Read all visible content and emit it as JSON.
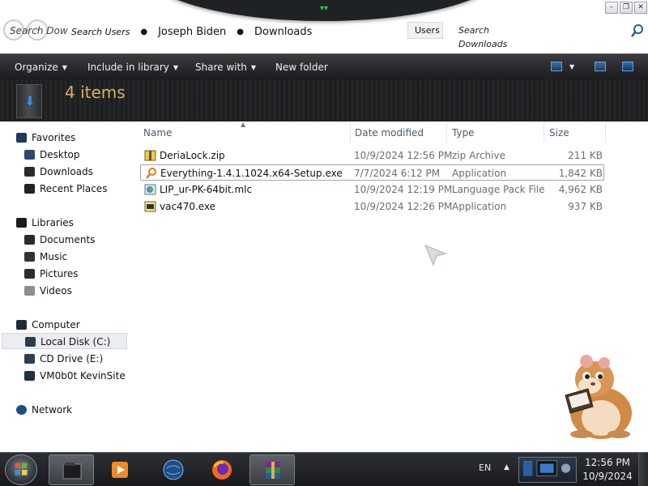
{
  "window": {
    "search_ghost": "Search Dow",
    "breadcrumb": [
      "Search Users",
      "Joseph Biden",
      "Downloads"
    ],
    "users_box": "Users",
    "search_placeholder": "Search Downloads",
    "search_icon": "magnifier-icon"
  },
  "toolbar": {
    "organize": "Organize",
    "include_in_library": "Include in library",
    "share_with": "Share with",
    "new_folder": "New folder"
  },
  "details": {
    "item_count": "4 items"
  },
  "navigation": {
    "favorites": {
      "label": "Favorites",
      "items": [
        "Desktop",
        "Downloads",
        "Recent Places"
      ]
    },
    "libraries": {
      "label": "Libraries",
      "items": [
        "Documents",
        "Music",
        "Pictures",
        "Videos"
      ]
    },
    "computer": {
      "label": "Computer",
      "items": [
        "Local Disk (C:)",
        "CD Drive (E:)",
        "VM0b0t KevinSite"
      ]
    },
    "network": {
      "label": "Network"
    },
    "selected": "Local Disk (C:)"
  },
  "columns": {
    "name": "Name",
    "date_modified": "Date modified",
    "type": "Type",
    "size": "Size"
  },
  "files": [
    {
      "name": "DeriaLock.zip",
      "date": "10/9/2024 12:56 PM",
      "type": "zip Archive",
      "size": "211 KB",
      "icon": "zip-archive-icon"
    },
    {
      "name": "Everything-1.4.1.1024.x64-Setup.exe",
      "date": "7/7/2024 6:12 PM",
      "type": "Application",
      "size": "1,842 KB",
      "icon": "magnifier-app-icon"
    },
    {
      "name": "LIP_ur-PK-64bit.mlc",
      "date": "10/9/2024 12:19 PM",
      "type": "Language Pack File",
      "size": "4,962 KB",
      "icon": "language-pack-icon"
    },
    {
      "name": "vac470.exe",
      "date": "10/9/2024 12:26 PM",
      "type": "Application",
      "size": "937 KB",
      "icon": "installer-icon"
    }
  ],
  "taskbar": {
    "language": "EN",
    "time": "12:56 PM",
    "date": "10/9/2024",
    "apps": [
      "explorer",
      "media-player",
      "browser-globe",
      "firefox",
      "winrar"
    ]
  },
  "colors": {
    "accent_gold": "#d7b06a",
    "selection_border": "#9aa7b6",
    "led_green": "#2fd33a"
  }
}
